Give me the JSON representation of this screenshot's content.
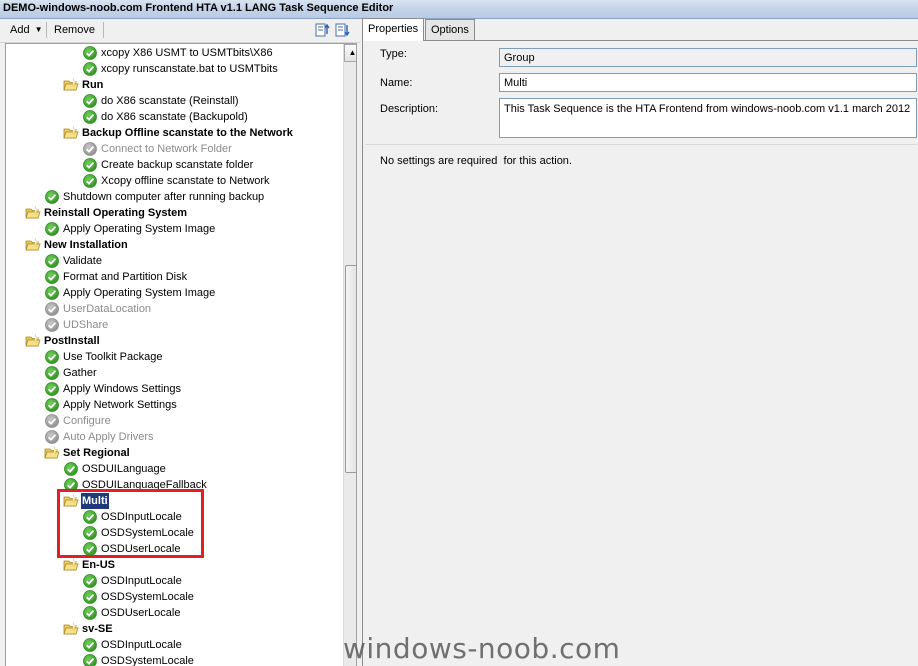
{
  "window": {
    "title": "DEMO-windows-noob.com Frontend HTA v1.1 LANG Task Sequence Editor"
  },
  "toolbar": {
    "add_label": "Add",
    "remove_label": "Remove"
  },
  "tree": {
    "nodes": [
      {
        "label": "xcopy X86 USMT to USMTbits\\X86",
        "type": "step"
      },
      {
        "label": "xcopy runscanstate.bat to USMTbits",
        "type": "step"
      },
      {
        "label": "Run",
        "type": "group"
      },
      {
        "label": "do X86 scanstate (Reinstall)",
        "type": "step"
      },
      {
        "label": "do X86 scanstate (Backupold)",
        "type": "step"
      },
      {
        "label": "Backup Offline scanstate to the Network",
        "type": "group"
      },
      {
        "label": "Connect to Network Folder",
        "type": "disabled"
      },
      {
        "label": "Create backup scanstate folder",
        "type": "step"
      },
      {
        "label": "Xcopy offline scanstate to Network",
        "type": "step"
      },
      {
        "label": "Shutdown computer after running backup",
        "type": "step"
      },
      {
        "label": "Reinstall Operating System",
        "type": "group"
      },
      {
        "label": "Apply Operating System Image",
        "type": "step"
      },
      {
        "label": "New Installation",
        "type": "group"
      },
      {
        "label": "Validate",
        "type": "step"
      },
      {
        "label": "Format and Partition Disk",
        "type": "step"
      },
      {
        "label": "Apply Operating System Image",
        "type": "step"
      },
      {
        "label": "UserDataLocation",
        "type": "disabled"
      },
      {
        "label": "UDShare",
        "type": "disabled"
      },
      {
        "label": "PostInstall",
        "type": "group"
      },
      {
        "label": "Use Toolkit Package",
        "type": "step"
      },
      {
        "label": "Gather",
        "type": "step"
      },
      {
        "label": "Apply Windows Settings",
        "type": "step"
      },
      {
        "label": "Apply Network Settings",
        "type": "step"
      },
      {
        "label": "Configure",
        "type": "disabled"
      },
      {
        "label": "Auto Apply Drivers",
        "type": "disabled"
      },
      {
        "label": "Set Regional",
        "type": "group"
      },
      {
        "label": "OSDUILanguage",
        "type": "step"
      },
      {
        "label": "OSDUILanguageFallback",
        "type": "step"
      },
      {
        "label": "Multi",
        "type": "group",
        "selected": true
      },
      {
        "label": "OSDInputLocale",
        "type": "step"
      },
      {
        "label": "OSDSystemLocale",
        "type": "step"
      },
      {
        "label": "OSDUserLocale",
        "type": "step"
      },
      {
        "label": "En-US",
        "type": "group"
      },
      {
        "label": "OSDInputLocale",
        "type": "step"
      },
      {
        "label": "OSDSystemLocale",
        "type": "step"
      },
      {
        "label": "OSDUserLocale",
        "type": "step"
      },
      {
        "label": "sv-SE",
        "type": "group"
      },
      {
        "label": "OSDInputLocale",
        "type": "step"
      },
      {
        "label": "OSDSystemLocale",
        "type": "step"
      }
    ]
  },
  "tabs": [
    {
      "label": "Properties",
      "active": true
    },
    {
      "label": "Options",
      "active": false
    }
  ],
  "properties": {
    "type_label": "Type:",
    "type_value": "Group",
    "name_label": "Name:",
    "name_value": "Multi",
    "description_label": "Description:",
    "description_value": "This Task Sequence is the HTA Frontend from windows-noob.com v1.1 march 2012",
    "note": "No settings are required  for this action."
  },
  "watermark": "windows-noob.com",
  "colors": {
    "highlight": "#e02028",
    "selection": "#1f3a7a",
    "check_green": "#3aa52a"
  },
  "icons": {
    "step": "green-check-icon",
    "disabled": "grey-check-icon",
    "group": "folder-icon"
  }
}
